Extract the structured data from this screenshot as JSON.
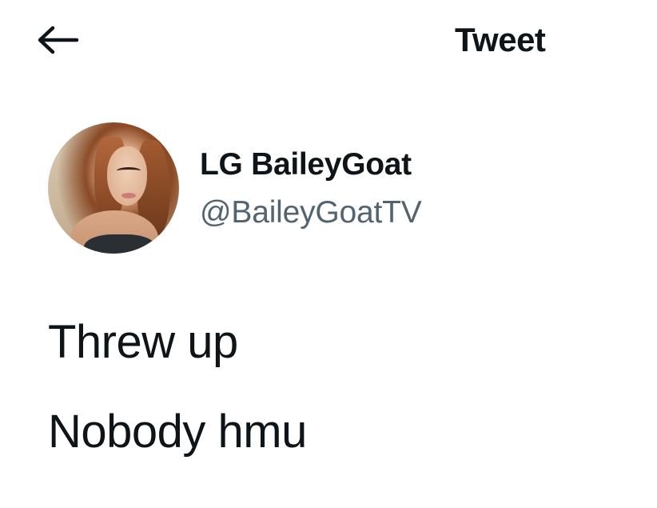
{
  "header": {
    "back_icon": "arrow-left-icon",
    "title": "Tweet"
  },
  "author": {
    "display_name": "LG BaileyGoat",
    "handle": "@BaileyGoatTV",
    "avatar": "profile-photo"
  },
  "tweet": {
    "lines": [
      "Threw up",
      "Nobody hmu"
    ]
  },
  "colors": {
    "text_primary": "#0f1419",
    "text_secondary": "#536471",
    "background": "#ffffff"
  }
}
